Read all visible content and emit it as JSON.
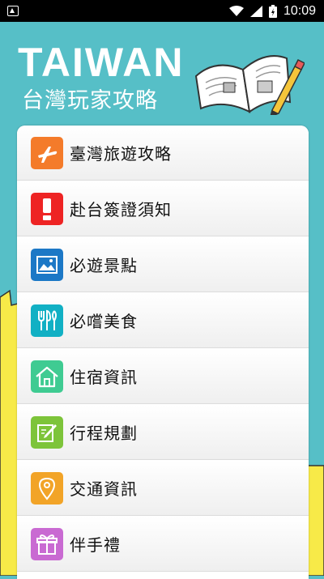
{
  "status_bar": {
    "time": "10:09"
  },
  "header": {
    "title": "TAIWAN",
    "subtitle": "台灣玩家攻略"
  },
  "colors": {
    "background": "#56bfc7"
  },
  "menu": [
    {
      "label": "臺灣旅遊攻略",
      "icon": "airplane-icon",
      "color": "#f47b2a"
    },
    {
      "label": "赴台簽證須知",
      "icon": "exclamation-icon",
      "color": "#ee2424"
    },
    {
      "label": "必遊景點",
      "icon": "picture-icon",
      "color": "#1c78c6"
    },
    {
      "label": "必嚐美食",
      "icon": "cutlery-icon",
      "color": "#11b0c4"
    },
    {
      "label": "住宿資訊",
      "icon": "home-icon",
      "color": "#3fcb92"
    },
    {
      "label": "行程規劃",
      "icon": "edit-icon",
      "color": "#7dc43a"
    },
    {
      "label": "交通資訊",
      "icon": "location-pin-icon",
      "color": "#f2a428"
    },
    {
      "label": "伴手禮",
      "icon": "gift-icon",
      "color": "#c96ad2"
    }
  ]
}
